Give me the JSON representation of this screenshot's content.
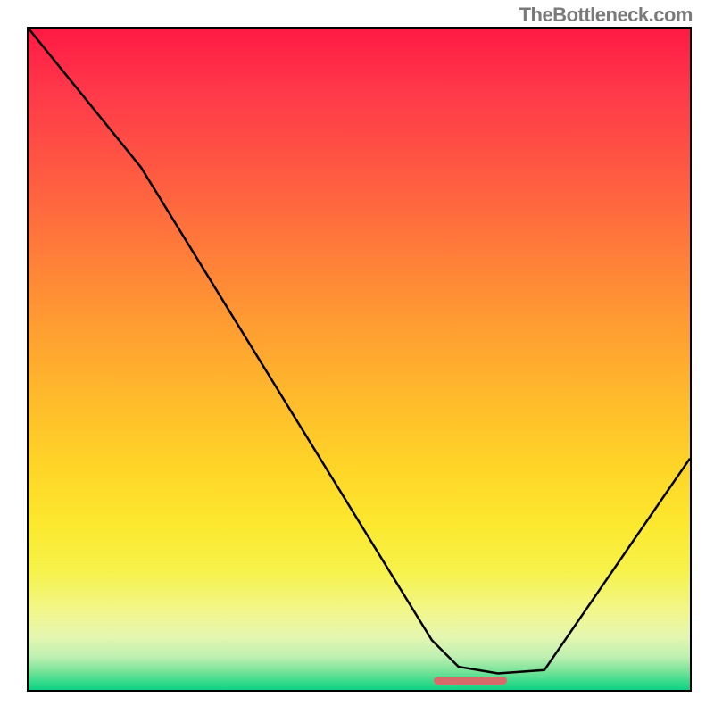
{
  "watermark": "TheBottleneck.com",
  "chart_data": {
    "type": "line",
    "title": "",
    "xlabel": "",
    "ylabel": "",
    "xlim": [
      0,
      100
    ],
    "ylim": [
      0,
      100
    ],
    "gradient": {
      "top_color": "#ff1a44",
      "mid_color": "#ffd428",
      "bottom_color": "#0fd084"
    },
    "series": [
      {
        "name": "curve",
        "x": [
          0,
          17,
          61,
          65,
          71,
          78,
          100
        ],
        "values": [
          100,
          79,
          7.5,
          3.5,
          2.5,
          3,
          35
        ]
      }
    ],
    "marker_band": {
      "x_start": 61,
      "x_end": 72,
      "y": 2,
      "color": "#d96a6a"
    }
  }
}
